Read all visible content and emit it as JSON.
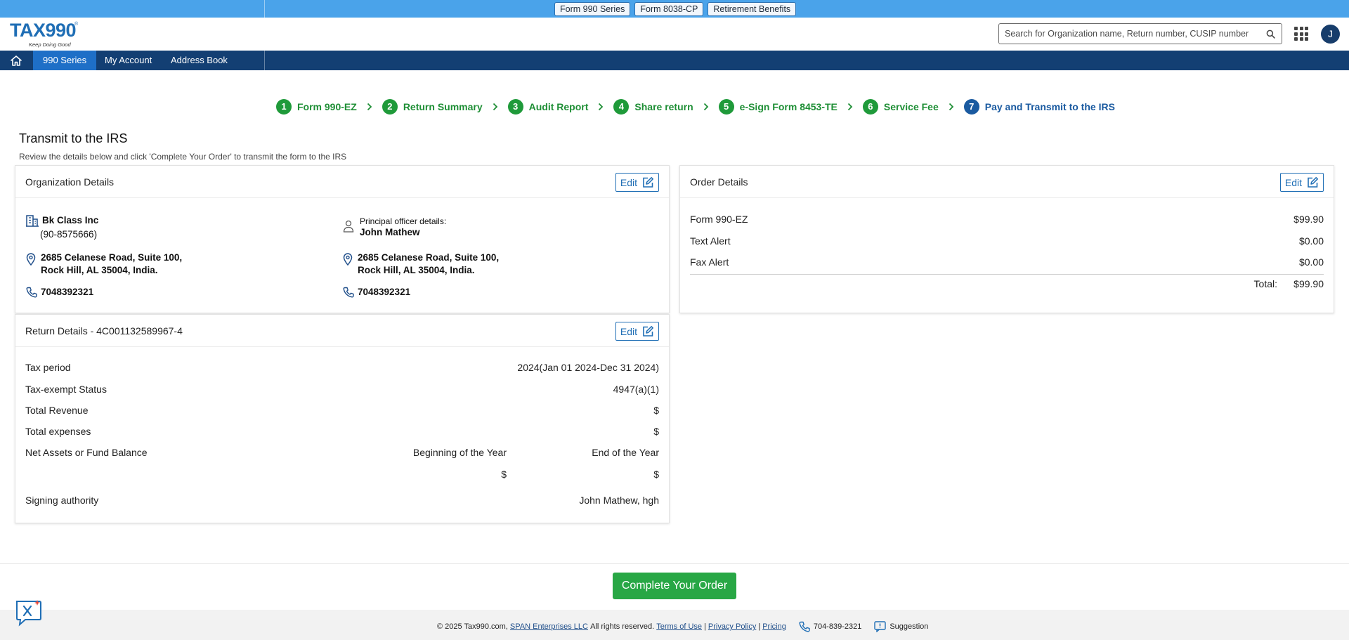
{
  "topbar": {
    "tabs": [
      "Form 990 Series",
      "Form 8038-CP",
      "Retirement Benefits"
    ]
  },
  "header": {
    "logo_text": "TAX990",
    "logo_tagline": "Keep Doing Good",
    "logo_reg": "®",
    "search_placeholder": "Search for Organization name, Return number, CUSIP number",
    "avatar_initial": "J"
  },
  "nav": {
    "items": [
      "990 Series",
      "My Account",
      "Address Book"
    ],
    "active_index": 0
  },
  "stepper": {
    "steps": [
      {
        "num": "1",
        "label": "Form 990-EZ"
      },
      {
        "num": "2",
        "label": "Return Summary"
      },
      {
        "num": "3",
        "label": "Audit Report"
      },
      {
        "num": "4",
        "label": "Share return"
      },
      {
        "num": "5",
        "label": "e-Sign Form 8453-TE"
      },
      {
        "num": "6",
        "label": "Service Fee"
      },
      {
        "num": "7",
        "label": "Pay and Transmit to the IRS"
      }
    ]
  },
  "page": {
    "title": "Transmit to the IRS",
    "subtitle": "Review the details below and click 'Complete Your Order' to transmit the form to the IRS"
  },
  "org": {
    "title": "Organization Details",
    "edit_label": "Edit",
    "name": "Bk Class Inc",
    "ein": "(90-8575666)",
    "address_line1": "2685 Celanese Road, Suite 100,",
    "address_line2": "Rock Hill, AL 35004, India.",
    "phone": "7048392321",
    "officer_caption": "Principal officer details:",
    "officer_name": "John Mathew",
    "officer_address_line1": "2685 Celanese Road, Suite 100,",
    "officer_address_line2": "Rock Hill, AL 35004, India.",
    "officer_phone": "7048392321"
  },
  "return": {
    "title": "Return Details - 4C001132589967-4",
    "edit_label": "Edit",
    "tax_period_label": "Tax period",
    "tax_period_value": "2024(Jan 01 2024-Dec 31 2024)",
    "status_label": "Tax-exempt Status",
    "status_value": "4947(a)(1)",
    "revenue_label": "Total Revenue",
    "revenue_value": "$",
    "expenses_label": "Total expenses",
    "expenses_value": "$",
    "net_assets_label": "Net Assets or Fund Balance",
    "beginning_label": "Beginning of the Year",
    "end_label": "End of the Year",
    "beginning_value": "$",
    "end_value": "$",
    "signing_label": "Signing authority",
    "signing_value": "John Mathew, hgh"
  },
  "order": {
    "title": "Order Details",
    "edit_label": "Edit",
    "items": [
      {
        "label": "Form 990-EZ",
        "value": "$99.90"
      },
      {
        "label": "Text Alert",
        "value": "$0.00"
      },
      {
        "label": "Fax Alert",
        "value": "$0.00"
      }
    ],
    "total_label": "Total:",
    "total_value": "$99.90"
  },
  "actions": {
    "complete_label": "Complete Your Order"
  },
  "footer": {
    "copyright": "© 2025 Tax990.com,",
    "company_link": "SPAN Enterprises LLC",
    "rights": "All rights reserved.",
    "terms": "Terms of Use",
    "privacy": "Privacy Policy",
    "pricing": "Pricing",
    "phone": "704-839-2321",
    "suggestion": "Suggestion"
  },
  "colors": {
    "topbar": "#4aa3ea",
    "navbar": "#133f73",
    "nav_active": "#1e6fc7",
    "step_done": "#1f9a3a",
    "step_current": "#1a5aa0",
    "primary_button": "#28a745",
    "link": "#1f6eb5"
  }
}
